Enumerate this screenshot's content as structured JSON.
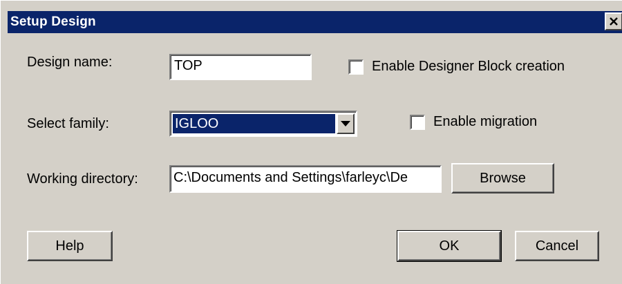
{
  "window": {
    "title": "Setup Design",
    "close_icon": "close-icon"
  },
  "form": {
    "design_name_label": "Design name:",
    "design_name_value": "TOP",
    "enable_designer_block_label": "Enable Designer Block creation",
    "enable_designer_block_checked": false,
    "select_family_label": "Select family:",
    "select_family_value": "IGLOO",
    "enable_migration_label": "Enable migration",
    "enable_migration_checked": false,
    "working_directory_label": "Working directory:",
    "working_directory_value": "C:\\Documents and Settings\\farleyc\\De",
    "browse_label": "Browse"
  },
  "buttons": {
    "help_label": "Help",
    "ok_label": "OK",
    "cancel_label": "Cancel"
  },
  "colors": {
    "titlebar": "#0a246a",
    "dialog_bg": "#d4d0c8",
    "selection": "#0a246a"
  }
}
